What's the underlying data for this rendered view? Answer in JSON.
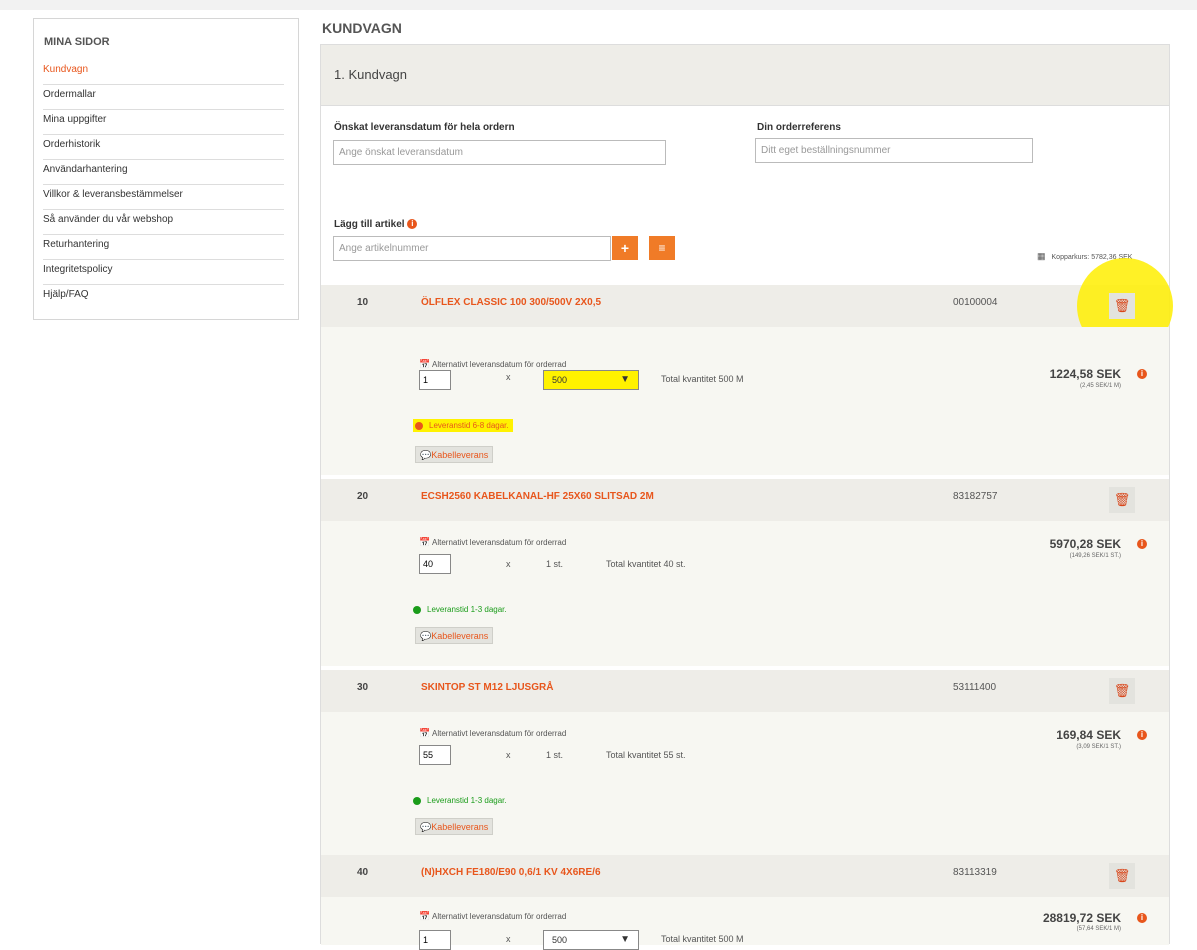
{
  "sidebar": {
    "title": "MINA SIDOR",
    "items": [
      {
        "label": "Kundvagn"
      },
      {
        "label": "Ordermallar"
      },
      {
        "label": "Mina uppgifter"
      },
      {
        "label": "Orderhistorik"
      },
      {
        "label": "Användarhantering"
      },
      {
        "label": "Villkor & leveransbestämmelser"
      },
      {
        "label": "Så använder du vår webshop"
      },
      {
        "label": "Returhantering"
      },
      {
        "label": "Integritetspolicy"
      },
      {
        "label": "Hjälp/FAQ"
      }
    ]
  },
  "page": {
    "title": "KUNDVAGN",
    "section": "1. Kundvagn"
  },
  "form": {
    "delivery_label": "Önskat leveransdatum för hela ordern",
    "delivery_placeholder": "Ange önskat leveransdatum",
    "ref_label": "Din orderreferens",
    "ref_placeholder": "Ditt eget beställningsnummer",
    "add_label": "Lägg till artikel",
    "add_placeholder": "Ange artikelnummer",
    "add_button": "+",
    "list_button": "≡",
    "copper": "Kopparkurs: 5782,36 SEK"
  },
  "rows": [
    {
      "num": "10",
      "name": "ÖLFLEX CLASSIC 100 300/500V 2X0,5",
      "article": "00100004",
      "alt_date": "Alternativt leveransdatum för orderrad",
      "qty": "1",
      "times": "x",
      "unit": "500",
      "total_qty": "Total kvantitet 500 M",
      "price": "1224,58 SEK",
      "per_unit": "(2,45 SEK/1 M)",
      "lead": "Leveranstid 6-8 dagar.",
      "kabel": "Kabelleverans"
    },
    {
      "num": "20",
      "name": "ECSH2560 KABELKANAL-HF 25X60 SLITSAD 2M",
      "article": "83182757",
      "alt_date": "Alternativt leveransdatum för orderrad",
      "qty": "40",
      "times": "x",
      "unit": "1 st.",
      "total_qty": "Total kvantitet 40 st.",
      "price": "5970,28 SEK",
      "per_unit": "(149,26 SEK/1 ST.)",
      "lead": "Leveranstid 1-3 dagar.",
      "kabel": "Kabelleverans"
    },
    {
      "num": "30",
      "name": "SKINTOP ST M12 LJUSGRÅ",
      "article": "53111400",
      "alt_date": "Alternativt leveransdatum för orderrad",
      "qty": "55",
      "times": "x",
      "unit": "1 st.",
      "total_qty": "Total kvantitet 55 st.",
      "price": "169,84 SEK",
      "per_unit": "(3,09 SEK/1 ST.)",
      "lead": "Leveranstid 1-3 dagar.",
      "kabel": "Kabelleverans"
    },
    {
      "num": "40",
      "name": "(N)HXCH FE180/E90 0,6/1 KV 4X6RE/6",
      "article": "83113319",
      "alt_date": "Alternativt leveransdatum för orderrad",
      "qty": "1",
      "times": "x",
      "unit": "500",
      "total_qty": "Total kvantitet 500 M",
      "price": "28819,72 SEK",
      "per_unit": "(57,64 SEK/1 M)"
    }
  ],
  "icons": {
    "trash": "🗑",
    "calendar": "📅",
    "info": "i",
    "comment": "💬",
    "copper": "▦"
  },
  "colors": {
    "accent": "#e8561c",
    "button": "#f07b27",
    "highlight": "#fff200",
    "green": "#1a9c1a",
    "row_head": "#eeede8"
  }
}
